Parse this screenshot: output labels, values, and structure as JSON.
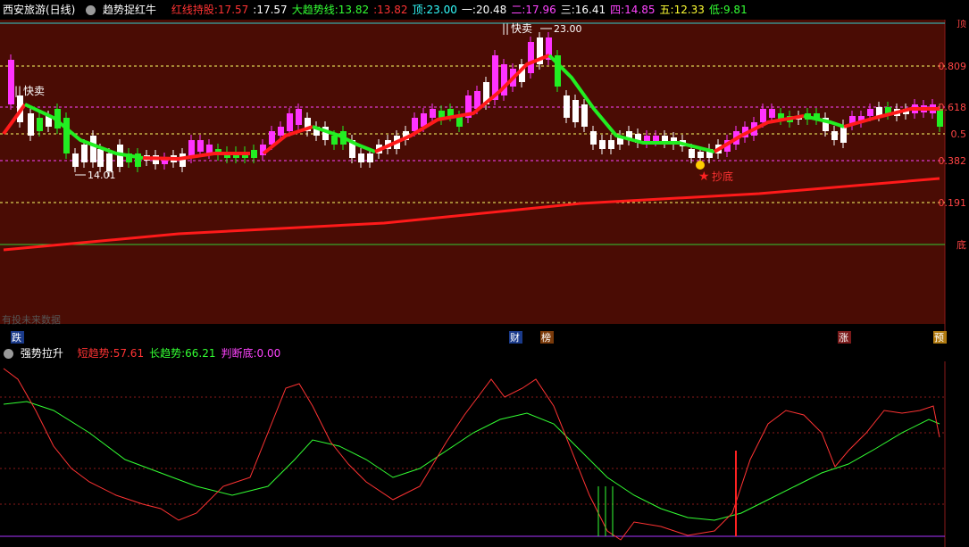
{
  "header": {
    "title": "西安旅游(日线)",
    "indicator_name": "趋势捉红牛",
    "fields": [
      {
        "label": "红线持股:",
        "value": "17.57",
        "color": "#ff3333"
      },
      {
        "label": ":",
        "value": "17.57",
        "color": "#ffffff"
      },
      {
        "label": "大趋势线:",
        "value": "13.82",
        "color": "#33ff33"
      },
      {
        "label": ":",
        "value": "13.82",
        "color": "#ff3333"
      },
      {
        "label": "顶:",
        "value": "23.00",
        "color": "#33ffff"
      },
      {
        "label": "一:",
        "value": "20.48",
        "color": "#ffffff"
      },
      {
        "label": "二:",
        "value": "17.96",
        "color": "#ff44ff"
      },
      {
        "label": "三:",
        "value": "16.41",
        "color": "#ffffff"
      },
      {
        "label": "四:",
        "value": "14.85",
        "color": "#ff44ff"
      },
      {
        "label": "五:",
        "value": "12.33",
        "color": "#ffff33"
      },
      {
        "label": "低:",
        "value": "9.81",
        "color": "#33ff33"
      }
    ]
  },
  "main_chart": {
    "right_labels": [
      "顶",
      "0.809",
      "0.618",
      "0.5",
      "0.382",
      "0.191",
      "底"
    ],
    "annotations": {
      "sell_1": "快卖",
      "sell_2": "快卖",
      "high_price": "23.00",
      "low_price": "14.01",
      "buy_signal": "抄底",
      "partial_text": "有投未来数据"
    },
    "bottom_tags": [
      {
        "text": "跌",
        "bg": "#1a3a8a",
        "color": "#ffffff"
      },
      {
        "text": "财",
        "bg": "#1a3a8a",
        "color": "#ffffff"
      },
      {
        "text": "榜",
        "bg": "#7a3a0a",
        "color": "#ffffff"
      },
      {
        "text": "涨",
        "bg": "#7a1a1a",
        "color": "#ffffff"
      },
      {
        "text": "预",
        "bg": "#b07a10",
        "color": "#ffffff"
      }
    ]
  },
  "sub_chart": {
    "name": "强势拉升",
    "fields": [
      {
        "label": "短趋势:",
        "value": "57.61",
        "color": "#ff3333"
      },
      {
        "label": "长趋势:",
        "value": "66.21",
        "color": "#33ff33"
      },
      {
        "label": "判断底:",
        "value": "0.00",
        "color": "#ff44ff"
      }
    ]
  },
  "colors": {
    "background_main": "#4a0c04",
    "fib_line": "#ff44ff",
    "trend_red": "#ff1a1a",
    "trend_green": "#22ee22",
    "candle_up": "#ff33ff",
    "candle_down": "#ffffff",
    "candle_green": "#22ee22"
  }
}
